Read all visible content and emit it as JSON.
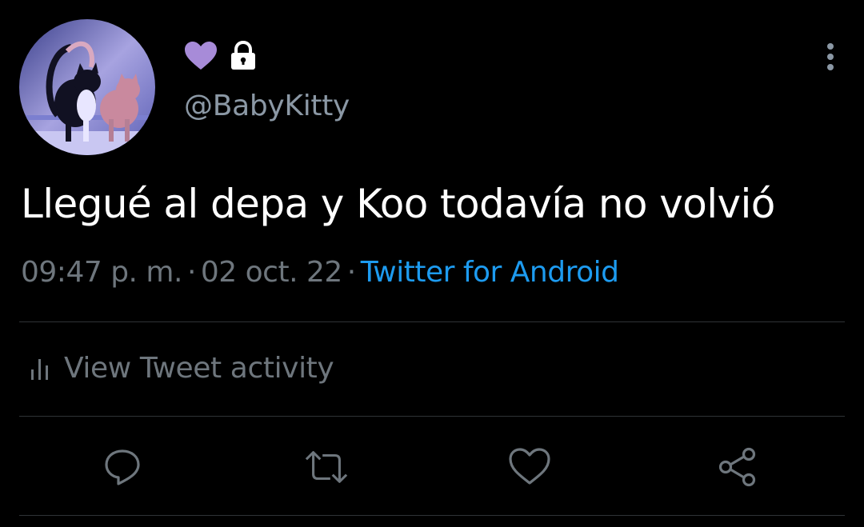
{
  "author": {
    "handle": "@BabyKitty",
    "avatar_icon": "cats-avatar",
    "display_name_icon": "purple-heart-icon",
    "lock_icon": "lock-icon"
  },
  "tweet": {
    "text": "Llegué al depa y Koo todavía no volvió",
    "time": "09:47 p. m.",
    "date": "02 oct. 22",
    "separator": "·",
    "source": "Twitter for Android"
  },
  "activity": {
    "label": "View Tweet activity",
    "icon": "bar-chart-icon"
  },
  "actions": {
    "reply": "reply-icon",
    "retweet": "retweet-icon",
    "like": "heart-icon",
    "share": "share-icon"
  },
  "colors": {
    "background": "#000000",
    "text_primary": "#ffffff",
    "text_secondary": "#6e767d",
    "handle": "#8b98a5",
    "link": "#1d9bf0",
    "heart_purple": "#a78bd8",
    "divider": "#2f3336"
  }
}
